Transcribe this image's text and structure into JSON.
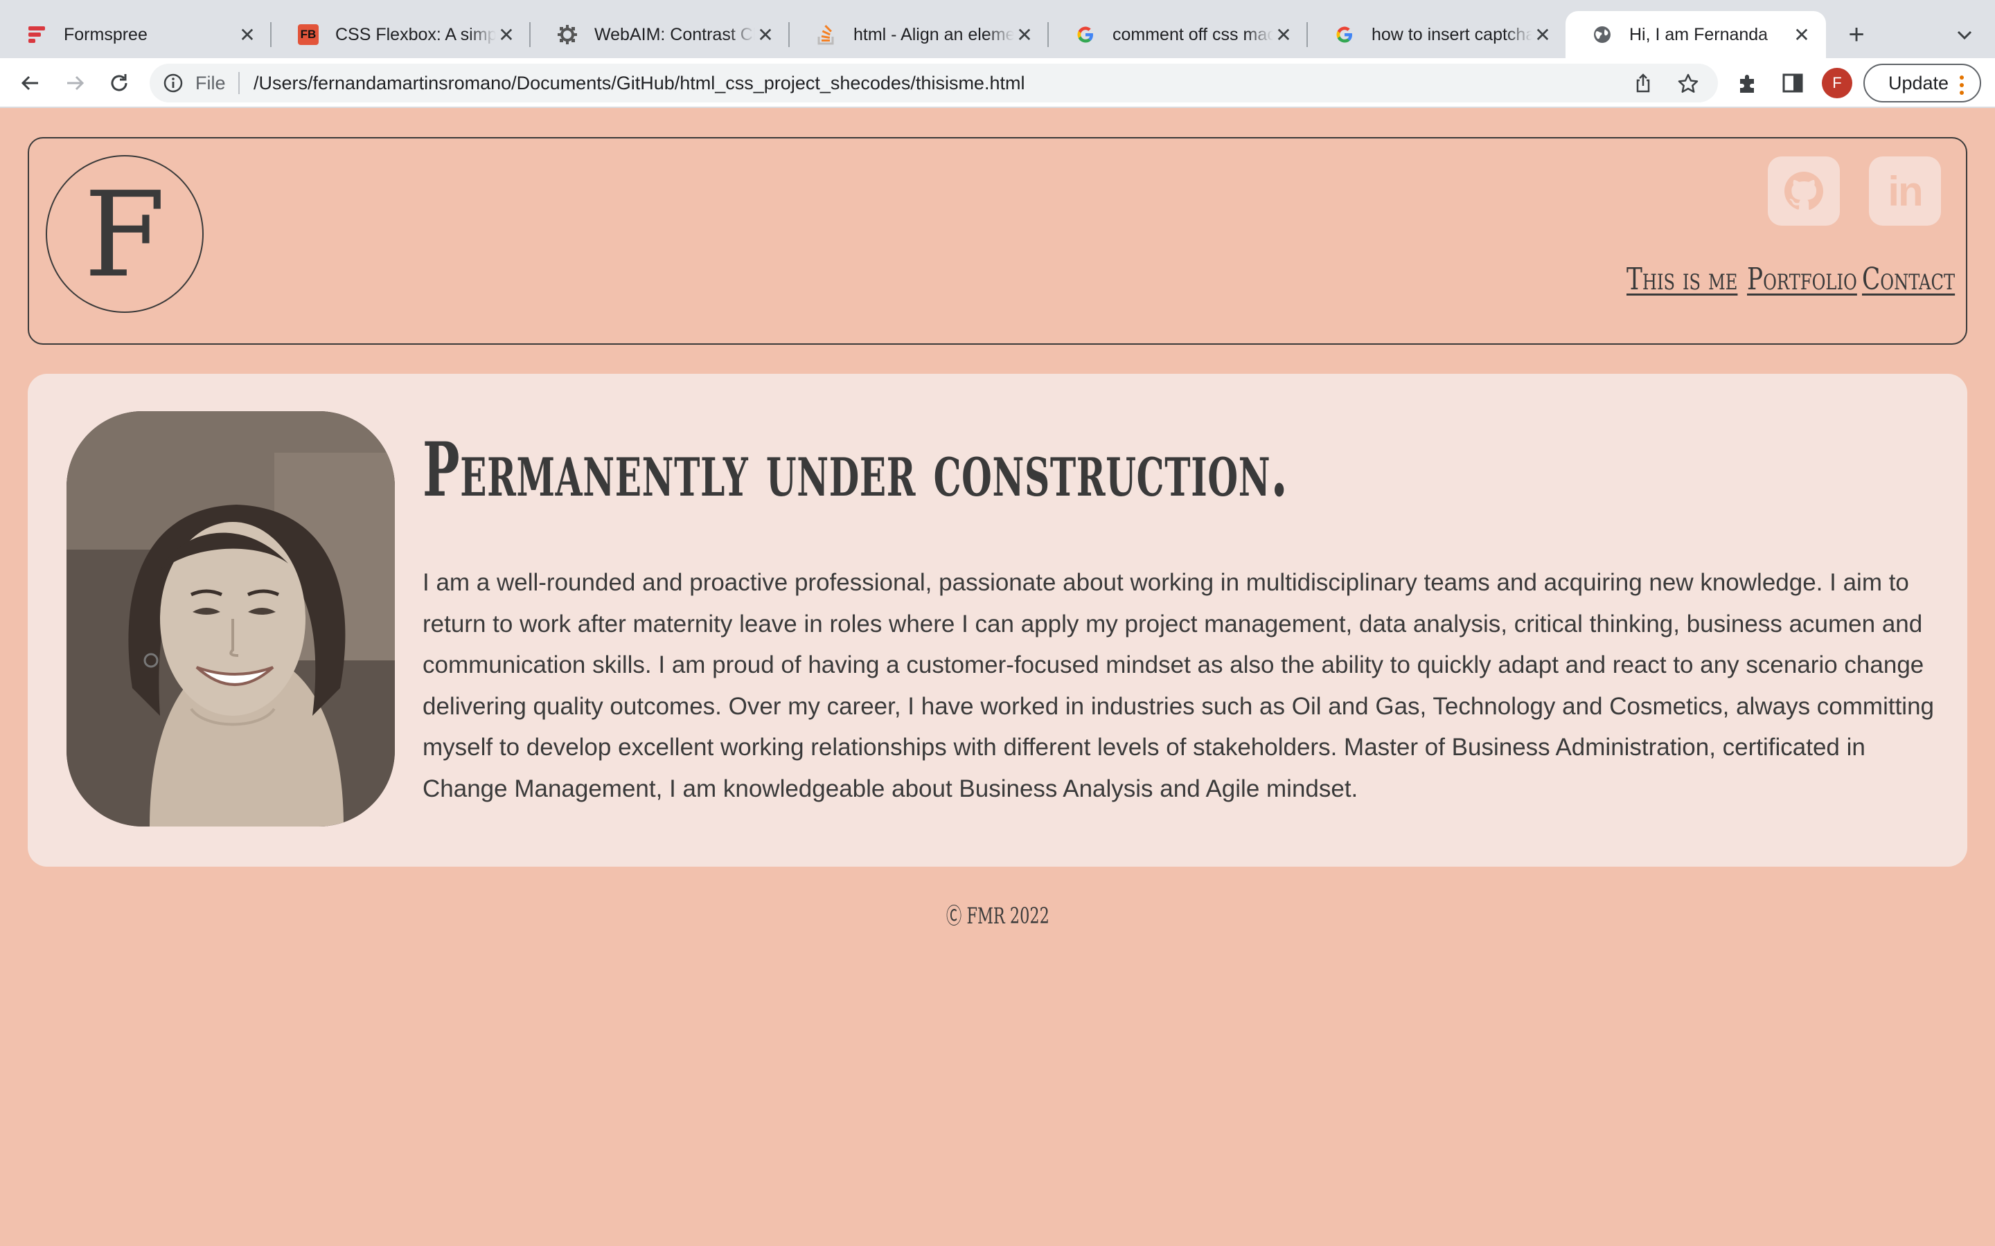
{
  "browser": {
    "tabs": [
      {
        "title": "Formspree",
        "icon": "formspree-icon",
        "active": false
      },
      {
        "title": "CSS Flexbox: A simple",
        "icon": "fb-icon",
        "fav_text": "FB",
        "active": false
      },
      {
        "title": "WebAIM: Contrast Ch",
        "icon": "webaim-icon",
        "active": false
      },
      {
        "title": "html - Align an elemen",
        "icon": "stackoverflow-icon",
        "active": false
      },
      {
        "title": "comment off css mac",
        "icon": "google-icon",
        "active": false
      },
      {
        "title": "how to insert captcha",
        "icon": "google-icon",
        "active": false
      },
      {
        "title": "Hi, I am Fernanda",
        "icon": "globe-icon",
        "active": true
      }
    ],
    "close_glyph": "✕",
    "new_tab_glyph": "+",
    "address": {
      "scheme_label": "File",
      "url": "/Users/fernandamartinsromano/Documents/GitHub/html_css_project_shecodes/thisisme.html"
    },
    "profile_initial": "F",
    "update_label": "Update",
    "colors": {
      "profile": "#c0392b",
      "formspree": "#d9383f",
      "fb": "#e2543a",
      "stackoverflow": "#f48024"
    }
  },
  "page": {
    "logo_letter": "F",
    "social": [
      {
        "name": "github",
        "icon": "github-icon"
      },
      {
        "name": "linkedin",
        "icon": "linkedin-icon",
        "text": "in"
      }
    ],
    "nav": [
      "This is me",
      "Portfolio",
      "Contact"
    ],
    "headline": "Permanently under construction.",
    "bio": "I am a well-rounded and proactive professional, passionate about working in multidisciplinary teams and acquiring new knowledge. I aim to return to work after maternity leave in roles where I can apply my project management, data analysis, critical thinking, business acumen and communication skills. I am proud of having a customer-focused mindset as also the ability to quickly adapt and react to any scenario change delivering quality outcomes. Over my career, I have worked in industries such as Oil and Gas, Technology and Cosmetics, always committing myself to develop excellent working relationships with different levels of stakeholders. Master of Business Administration, certificated in Change Management, I am knowledgeable about Business Analysis and Agile mindset.",
    "footer": "Ⓒ FMR 2022",
    "colors": {
      "background": "#f2c1ad",
      "card": "#f5e3dd",
      "text": "#3a3a3a",
      "social_bg": "#f6dcd3"
    }
  }
}
